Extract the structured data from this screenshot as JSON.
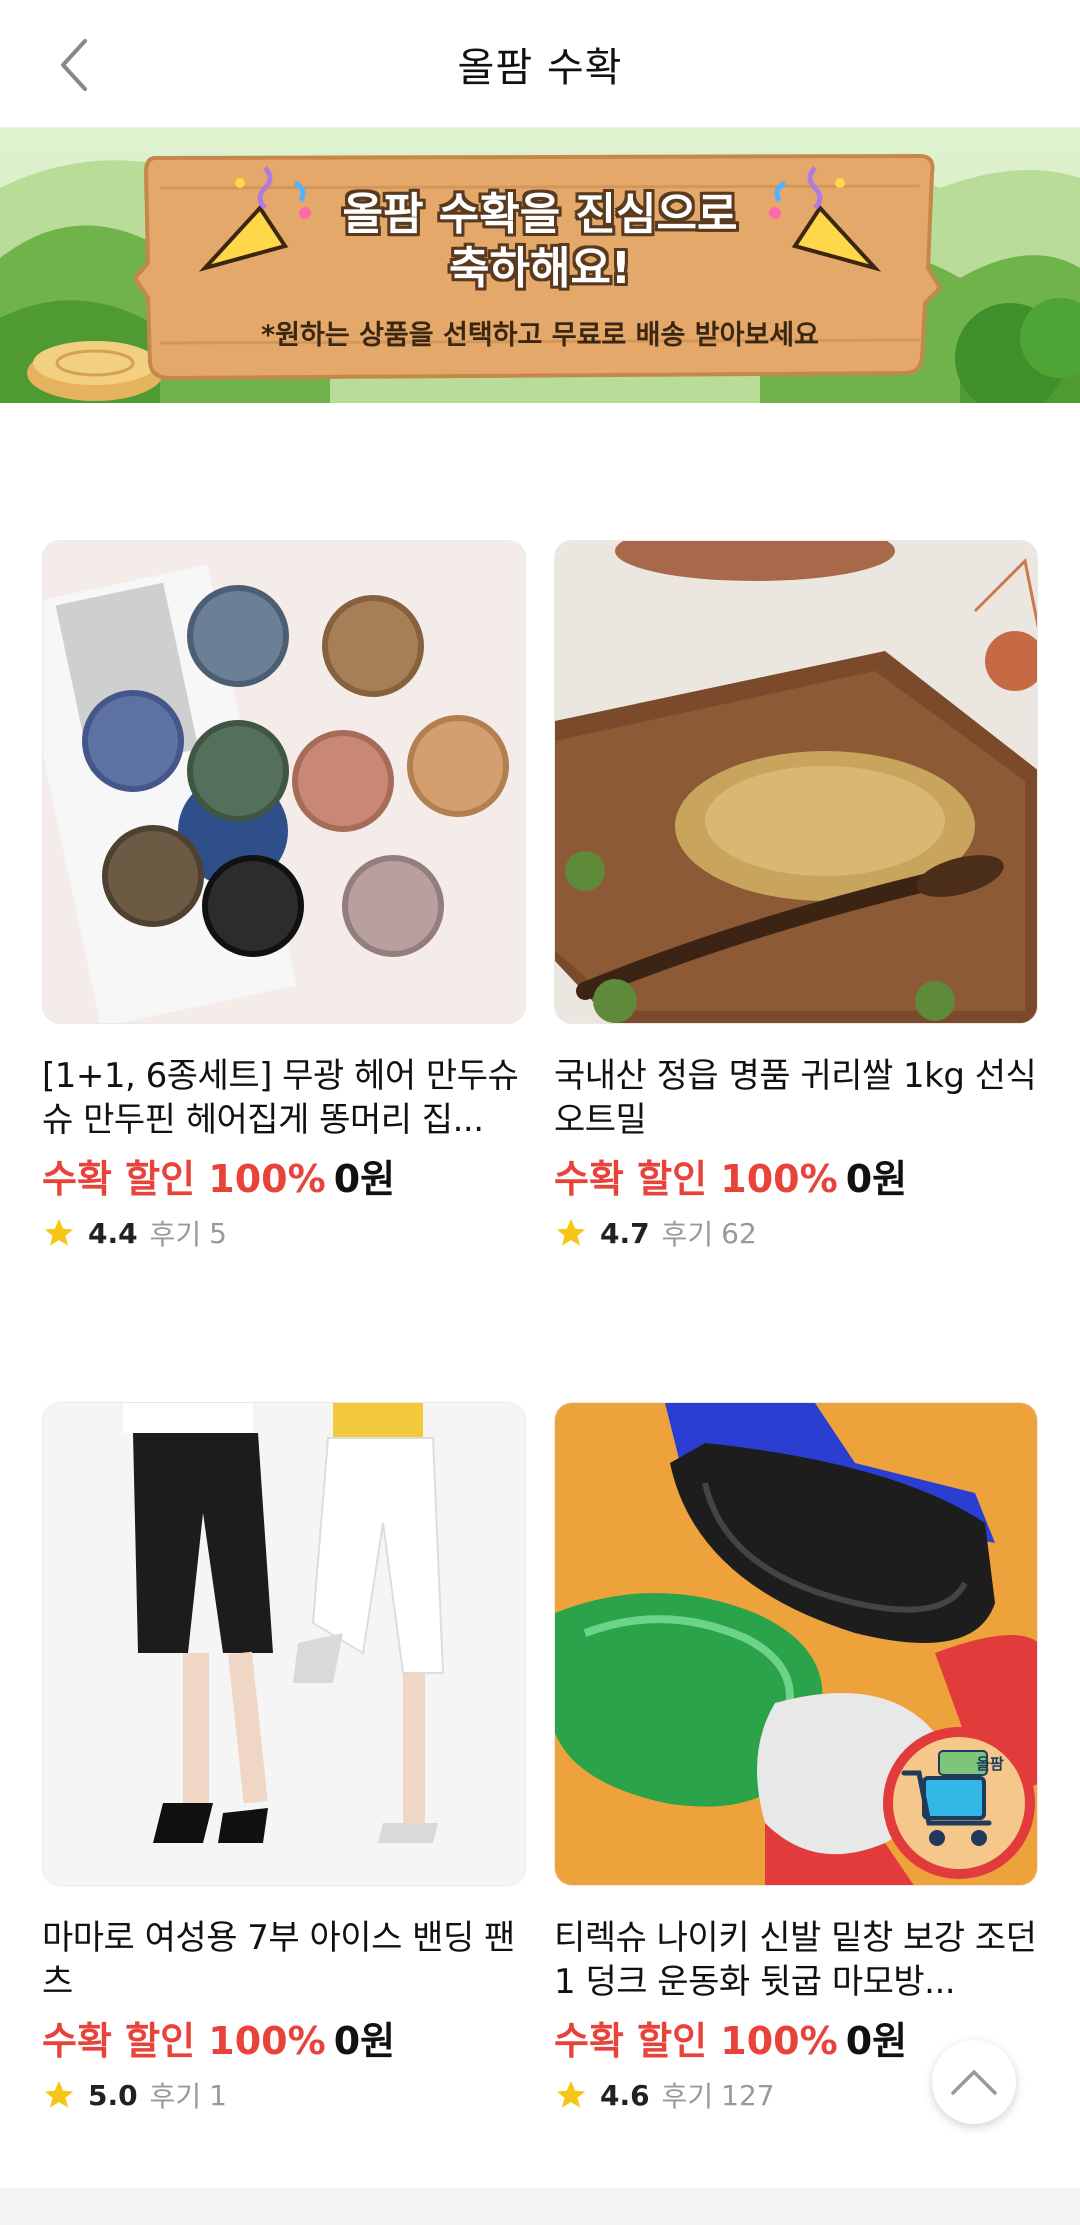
{
  "header": {
    "title": "올팜 수확"
  },
  "banner": {
    "title_line1": "올팜 수확을 진심으로",
    "title_line2": "축하해요!",
    "subtitle": "*원하는 상품을 선택하고 무료로 배송 받아보세요"
  },
  "products": [
    {
      "name": "[1+1, 6종세트] 무광 헤어 만두슈 슈 만두핀 헤어집게 똥머리 집...",
      "discount_label": "수확 할인 100%",
      "price": "0원",
      "rating": "4.4",
      "review_label": "후기",
      "review_count": "5"
    },
    {
      "name": "국내산 정읍 명품 귀리쌀 1kg 선식 오트밀",
      "discount_label": "수확 할인 100%",
      "price": "0원",
      "rating": "4.7",
      "review_label": "후기",
      "review_count": "62"
    },
    {
      "name": "마마로 여성용 7부 아이스 밴딩 팬츠",
      "discount_label": "수확 할인 100%",
      "price": "0원",
      "rating": "5.0",
      "review_label": "후기",
      "review_count": "1"
    },
    {
      "name": "티렉슈 나이키 신발 밑창 보강 조던 1 덩크 운동화 뒷굽 마모방...",
      "discount_label": "수확 할인 100%",
      "price": "0원",
      "rating": "4.6",
      "review_label": "후기",
      "review_count": "127"
    }
  ],
  "badge": {
    "text": "올팜"
  },
  "colors": {
    "accent_red": "#e8433a",
    "star_yellow": "#f5c518",
    "wood": "#e3a86a"
  },
  "icons": [
    "back-arrow-icon",
    "star-icon",
    "scroll-top-icon",
    "shopping-cart-icon"
  ]
}
